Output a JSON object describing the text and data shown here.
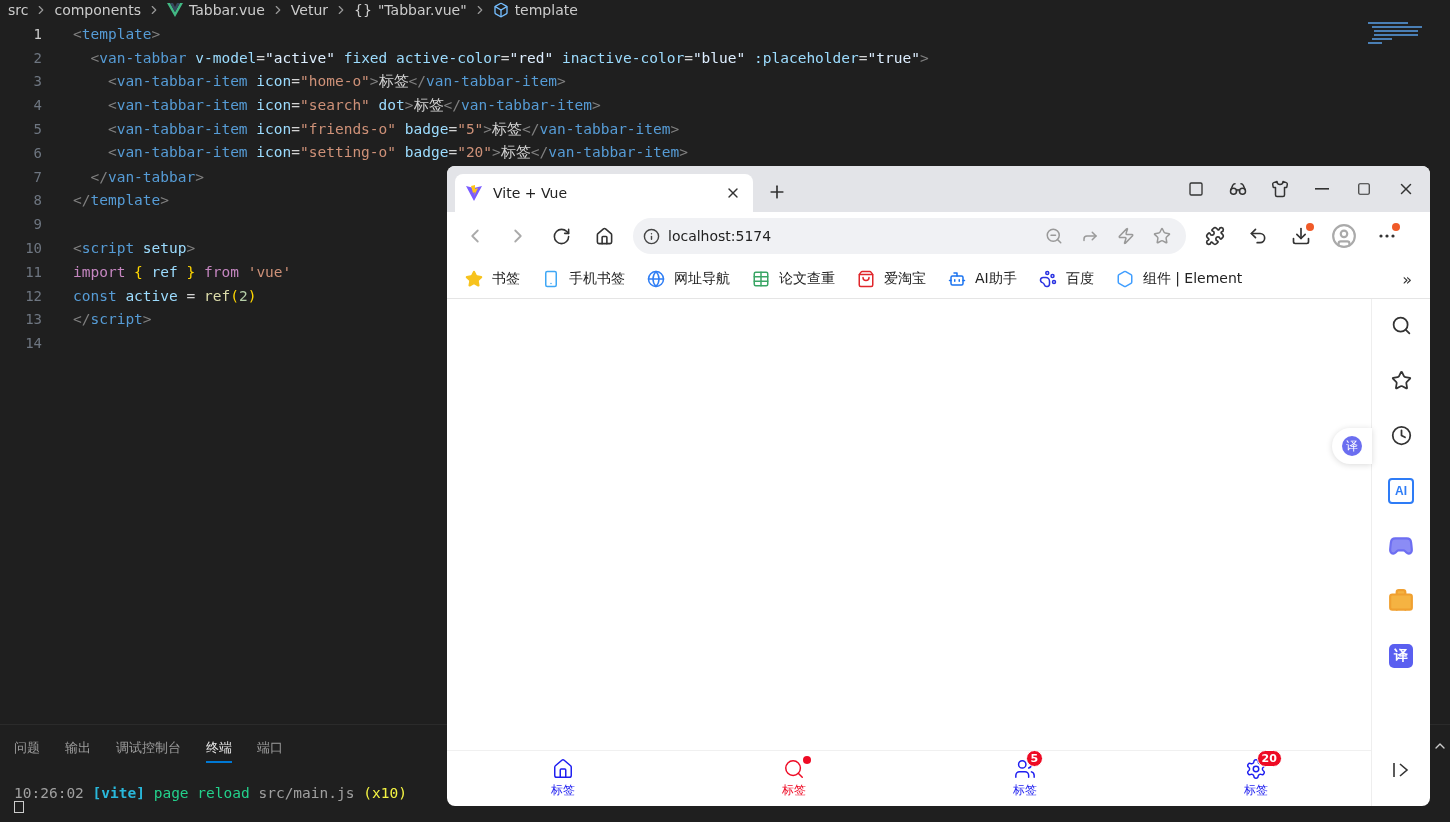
{
  "breadcrumb": [
    {
      "kind": "text",
      "label": "src"
    },
    {
      "kind": "text",
      "label": "components"
    },
    {
      "kind": "vue",
      "label": "Tabbar.vue"
    },
    {
      "kind": "text",
      "label": "Vetur"
    },
    {
      "kind": "braces",
      "glyph": "{}",
      "label": "\"Tabbar.vue\""
    },
    {
      "kind": "cube",
      "label": "template"
    }
  ],
  "editor": {
    "lines": [
      {
        "number": "1",
        "active": true,
        "tokens": [
          {
            "text": "<",
            "kind": "punct"
          },
          {
            "text": "template",
            "kind": "tag"
          },
          {
            "text": ">",
            "kind": "punct"
          }
        ]
      },
      {
        "number": "2",
        "active": false,
        "tokens": [
          {
            "text": "  <",
            "kind": "punct"
          },
          {
            "text": "van-tabbar",
            "kind": "tag"
          },
          {
            "text": " v-model",
            "kind": "attr"
          },
          {
            "text": "=",
            "kind": "plain"
          },
          {
            "text": "\"active\"",
            "kind": "val"
          },
          {
            "text": " fixed active-color",
            "kind": "attr"
          },
          {
            "text": "=",
            "kind": "plain"
          },
          {
            "text": "\"red\"",
            "kind": "val"
          },
          {
            "text": " inactive-color",
            "kind": "attr"
          },
          {
            "text": "=",
            "kind": "plain"
          },
          {
            "text": "\"blue\"",
            "kind": "val"
          },
          {
            "text": " :placeholder",
            "kind": "attr"
          },
          {
            "text": "=",
            "kind": "plain"
          },
          {
            "text": "\"true\"",
            "kind": "val"
          },
          {
            "text": ">",
            "kind": "punct"
          }
        ]
      },
      {
        "number": "3",
        "active": false,
        "tokens": [
          {
            "text": "    <",
            "kind": "punct"
          },
          {
            "text": "van-tabbar-item",
            "kind": "tag"
          },
          {
            "text": " icon",
            "kind": "attr"
          },
          {
            "text": "=",
            "kind": "plain"
          },
          {
            "text": "\"home-o\"",
            "kind": "str"
          },
          {
            "text": ">",
            "kind": "punct"
          },
          {
            "text": "标签",
            "kind": "plain"
          },
          {
            "text": "</",
            "kind": "punct"
          },
          {
            "text": "van-tabbar-item",
            "kind": "tag"
          },
          {
            "text": ">",
            "kind": "punct"
          }
        ]
      },
      {
        "number": "4",
        "active": false,
        "tokens": [
          {
            "text": "    <",
            "kind": "punct"
          },
          {
            "text": "van-tabbar-item",
            "kind": "tag"
          },
          {
            "text": " icon",
            "kind": "attr"
          },
          {
            "text": "=",
            "kind": "plain"
          },
          {
            "text": "\"search\"",
            "kind": "str"
          },
          {
            "text": " dot",
            "kind": "attr"
          },
          {
            "text": ">",
            "kind": "punct"
          },
          {
            "text": "标签",
            "kind": "plain"
          },
          {
            "text": "</",
            "kind": "punct"
          },
          {
            "text": "van-tabbar-item",
            "kind": "tag"
          },
          {
            "text": ">",
            "kind": "punct"
          }
        ]
      },
      {
        "number": "5",
        "active": false,
        "tokens": [
          {
            "text": "    <",
            "kind": "punct"
          },
          {
            "text": "van-tabbar-item",
            "kind": "tag"
          },
          {
            "text": " icon",
            "kind": "attr"
          },
          {
            "text": "=",
            "kind": "plain"
          },
          {
            "text": "\"friends-o\"",
            "kind": "str"
          },
          {
            "text": " badge",
            "kind": "attr"
          },
          {
            "text": "=",
            "kind": "plain"
          },
          {
            "text": "\"5\"",
            "kind": "str"
          },
          {
            "text": ">",
            "kind": "punct"
          },
          {
            "text": "标签",
            "kind": "plain"
          },
          {
            "text": "</",
            "kind": "punct"
          },
          {
            "text": "van-tabbar-item",
            "kind": "tag"
          },
          {
            "text": ">",
            "kind": "punct"
          }
        ]
      },
      {
        "number": "6",
        "active": false,
        "tokens": [
          {
            "text": "    <",
            "kind": "punct"
          },
          {
            "text": "van-tabbar-item",
            "kind": "tag"
          },
          {
            "text": " icon",
            "kind": "attr"
          },
          {
            "text": "=",
            "kind": "plain"
          },
          {
            "text": "\"setting-o\"",
            "kind": "str"
          },
          {
            "text": " badge",
            "kind": "attr"
          },
          {
            "text": "=",
            "kind": "plain"
          },
          {
            "text": "\"20\"",
            "kind": "str"
          },
          {
            "text": ">",
            "kind": "punct"
          },
          {
            "text": "标签",
            "kind": "plain"
          },
          {
            "text": "</",
            "kind": "punct"
          },
          {
            "text": "van-tabbar-item",
            "kind": "tag"
          },
          {
            "text": ">",
            "kind": "punct"
          }
        ]
      },
      {
        "number": "7",
        "active": false,
        "tokens": [
          {
            "text": "  </",
            "kind": "punct"
          },
          {
            "text": "van-tabbar",
            "kind": "tag"
          },
          {
            "text": ">",
            "kind": "punct"
          }
        ]
      },
      {
        "number": "8",
        "active": false,
        "tokens": [
          {
            "text": "</",
            "kind": "punct"
          },
          {
            "text": "template",
            "kind": "tag"
          },
          {
            "text": ">",
            "kind": "punct"
          }
        ]
      },
      {
        "number": "9",
        "active": false
      },
      {
        "number": "10",
        "active": false,
        "tokens": [
          {
            "text": "<",
            "kind": "punct"
          },
          {
            "text": "script",
            "kind": "tag"
          },
          {
            "text": " setup",
            "kind": "attr"
          },
          {
            "text": ">",
            "kind": "punct"
          }
        ]
      },
      {
        "number": "11",
        "active": false,
        "tokens": [
          {
            "text": "import",
            "kind": "kw"
          },
          {
            "text": " { ",
            "kind": "brace"
          },
          {
            "text": "ref",
            "kind": "attr"
          },
          {
            "text": " } ",
            "kind": "brace"
          },
          {
            "text": "from",
            "kind": "kw"
          },
          {
            "text": " 'vue'",
            "kind": "str"
          }
        ]
      },
      {
        "number": "12",
        "active": false,
        "tokens": [
          {
            "text": "const",
            "kind": "tag"
          },
          {
            "text": " active",
            "kind": "attr"
          },
          {
            "text": " = ",
            "kind": "plain"
          },
          {
            "text": "ref",
            "kind": "fn"
          },
          {
            "text": "(",
            "kind": "brace"
          },
          {
            "text": "2",
            "kind": "num"
          },
          {
            "text": ")",
            "kind": "brace"
          }
        ]
      },
      {
        "number": "13",
        "active": false,
        "tokens": [
          {
            "text": "</",
            "kind": "punct"
          },
          {
            "text": "script",
            "kind": "tag"
          },
          {
            "text": ">",
            "kind": "punct"
          }
        ]
      },
      {
        "number": "14",
        "active": false
      }
    ]
  },
  "panel": {
    "tabs": [
      {
        "label": "问题",
        "selected": false
      },
      {
        "label": "输出",
        "selected": false
      },
      {
        "label": "调试控制台",
        "selected": false
      },
      {
        "label": "终端",
        "selected": true
      },
      {
        "label": "端口",
        "selected": false
      }
    ],
    "terminal": [
      {
        "text": "10:26:02",
        "kind": "dim"
      },
      {
        "text": " [vite]",
        "kind": "vite"
      },
      {
        "text": " page reload",
        "kind": "green"
      },
      {
        "text": " src/main.js",
        "kind": "dim"
      },
      {
        "text": " (x10)",
        "kind": "yellow"
      }
    ]
  },
  "browser": {
    "tab_title": "Vite + Vue",
    "url": "localhost:5174",
    "bookmarks": [
      {
        "kind": "star",
        "label": "书签"
      },
      {
        "kind": "phone",
        "label": "手机书签"
      },
      {
        "kind": "globe",
        "label": "网址导航"
      },
      {
        "kind": "sheet",
        "label": "论文查重"
      },
      {
        "kind": "shop",
        "label": "爱淘宝"
      },
      {
        "kind": "bot",
        "label": "AI助手"
      },
      {
        "kind": "paw",
        "label": "百度"
      },
      {
        "kind": "element",
        "label": "组件 | Element"
      }
    ],
    "more": "»",
    "float_button": "译",
    "side": [
      {
        "kind": "search"
      },
      {
        "kind": "star"
      },
      {
        "kind": "clock"
      },
      {
        "kind": "ai",
        "label": "AI"
      },
      {
        "kind": "game"
      },
      {
        "kind": "case"
      },
      {
        "kind": "translate",
        "label": "译"
      }
    ],
    "tabbar": {
      "items": [
        {
          "kind": "home",
          "label": "标签",
          "selected": false
        },
        {
          "kind": "search",
          "label": "标签",
          "selected": true,
          "dot": true
        },
        {
          "kind": "friends",
          "label": "标签",
          "selected": false,
          "badge": "5"
        },
        {
          "kind": "setting",
          "label": "标签",
          "selected": false,
          "badge": "20"
        }
      ]
    }
  }
}
